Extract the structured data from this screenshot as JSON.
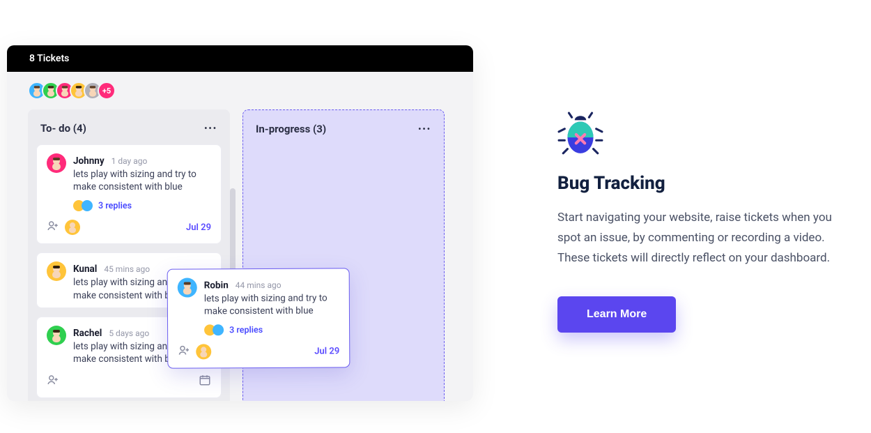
{
  "header": {
    "title": "8 Tickets"
  },
  "avatars": {
    "colors": [
      "#3fb5ff",
      "#2fcf4f",
      "#ff2b7a",
      "#ffc43a",
      "#b0b0b8"
    ],
    "more": "+5"
  },
  "columns": {
    "todo": {
      "title": "To- do (4)"
    },
    "inprogress": {
      "title": "In-progress (3)"
    }
  },
  "cards": {
    "johnny": {
      "name": "Johnny",
      "time": "1 day ago",
      "desc": "lets play with sizing and try to make consistent with blue",
      "replies": "3 replies",
      "date": "Jul 29"
    },
    "kunal": {
      "name": "Kunal",
      "time": "45 mins ago",
      "desc": "lets play with sizing and try to make consistent with blue"
    },
    "rachel": {
      "name": "Rachel",
      "time": "5 days ago",
      "desc": "lets play with sizing and try to make consistent with blue"
    },
    "robin": {
      "name": "Robin",
      "time": "44 mins ago",
      "desc": "lets play with sizing and try to make consistent with blue",
      "replies": "3 replies",
      "date": "Jul 29"
    }
  },
  "feature": {
    "title": "Bug Tracking",
    "desc": "Start navigating your website, raise tickets when you spot an issue, by commenting or recording a video. These tickets will directly reflect on your dashboard.",
    "cta": "Learn More"
  }
}
